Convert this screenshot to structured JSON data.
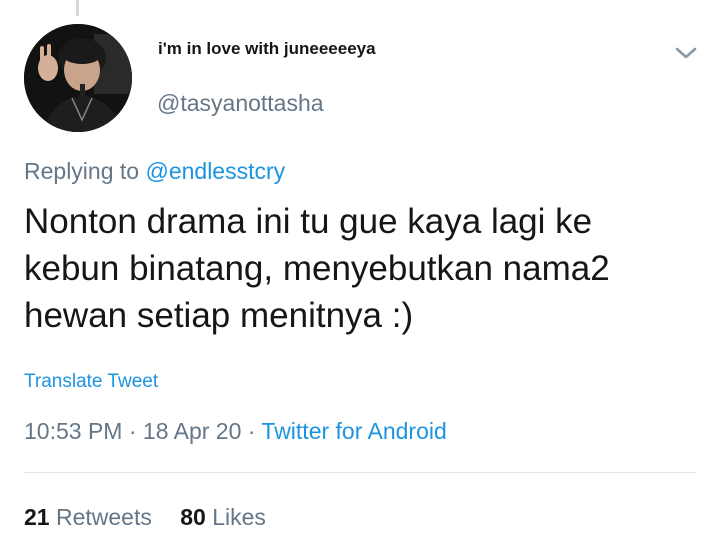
{
  "tweet": {
    "display_name": "i'm in love with juneeeeeya",
    "handle": "@tasyanottasha",
    "replying_prefix": "Replying to",
    "replying_mention": "@endlesstcry",
    "text_lines": [
      "Nonton drama ini tu gue kaya lagi ke",
      "kebun binatang, menyebutkan nama2",
      "hewan setiap menitnya :)"
    ],
    "translate_label": "Translate Tweet",
    "time": "10:53 PM",
    "separator": "·",
    "date": "18 Apr 20",
    "source": "Twitter for Android",
    "retweets_count": "21",
    "retweets_label": "Retweets",
    "likes_count": "80",
    "likes_label": "Likes"
  },
  "icons": {
    "more_menu": "chevron-down-icon",
    "avatar": "profile-photo"
  },
  "colors": {
    "text_primary": "#14171a",
    "text_secondary": "#657786",
    "link": "#1b95e0",
    "divider": "#e1e8ed"
  }
}
